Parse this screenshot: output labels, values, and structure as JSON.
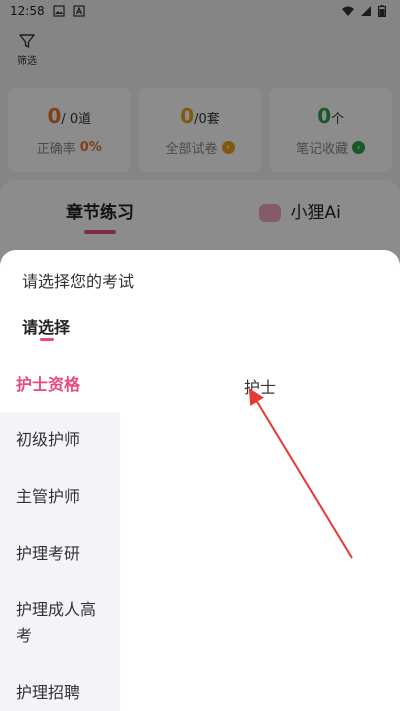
{
  "status_bar": {
    "time": "12:58"
  },
  "toolbar": {
    "filter_label": "筛选"
  },
  "stats": [
    {
      "value": "0",
      "unit": "/ 0道",
      "value_color": "#e8742c",
      "sub_label": "正确率",
      "sub_value": "0%"
    },
    {
      "value": "0",
      "unit": "/0套",
      "value_color": "#e5a31e",
      "sub_label": "全部试卷"
    },
    {
      "value": "0",
      "unit": "个",
      "value_color": "#2aa34a",
      "sub_label": "笔记收藏"
    }
  ],
  "tabs": [
    {
      "label": "章节练习"
    },
    {
      "label": "小狸Ai"
    }
  ],
  "sheet": {
    "title": "请选择您的考试",
    "tab_label": "请选择",
    "categories": [
      "护士资格",
      "初级护师",
      "主管护师",
      "护理考研",
      "护理成人高考",
      "护理招聘"
    ],
    "selected_category_index": 0,
    "options": [
      "护士"
    ]
  },
  "colors": {
    "accent": "#e64b7f",
    "annotation_arrow": "#e53935"
  }
}
